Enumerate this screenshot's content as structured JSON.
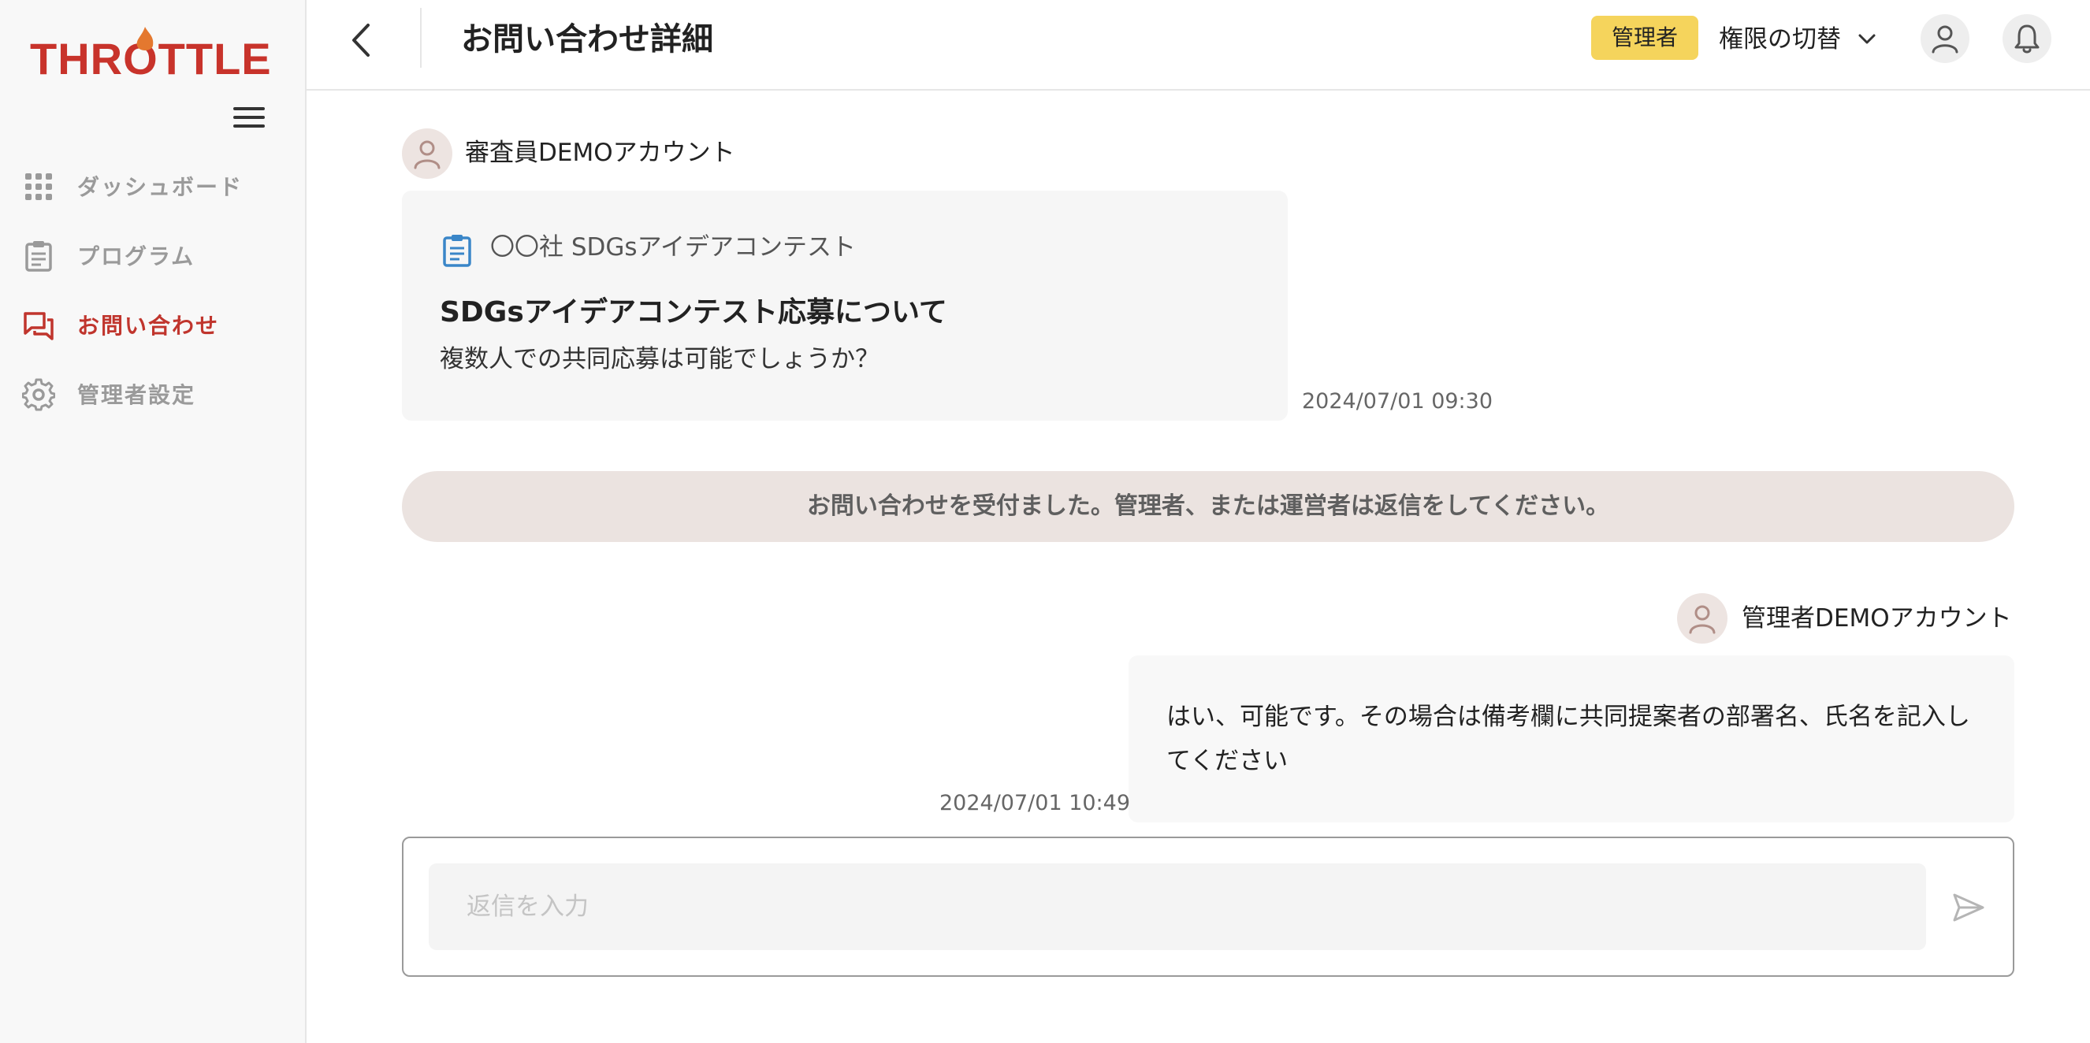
{
  "sidebar": {
    "logo_text": "THROTTLE",
    "items": [
      {
        "label": "ダッシュボード",
        "icon": "grid-icon",
        "active": false
      },
      {
        "label": "プログラム",
        "icon": "clipboard-icon",
        "active": false
      },
      {
        "label": "お問い合わせ",
        "icon": "chat-icon",
        "active": true
      },
      {
        "label": "管理者設定",
        "icon": "gear-icon",
        "active": false
      }
    ]
  },
  "header": {
    "title": "お問い合わせ詳細",
    "role_badge": "管理者",
    "role_switch_label": "権限の切替"
  },
  "thread": {
    "inquiry": {
      "sender": "審査員DEMOアカウント",
      "program": "〇〇社 SDGsアイデアコンテスト",
      "subject": "SDGsアイデアコンテスト応募について",
      "body": "複数人での共同応募は可能でしょうか？",
      "timestamp": "2024/07/01 09:30"
    },
    "system_message": "お問い合わせを受付ました。管理者、または運営者は返信をしてください。",
    "reply": {
      "sender": "管理者DEMOアカウント",
      "body": "はい、可能です。その場合は備考欄に共同提案者の部署名、氏名を記入してください",
      "timestamp": "2024/07/01 10:49"
    }
  },
  "composer": {
    "placeholder": "返信を入力",
    "value": ""
  },
  "colors": {
    "brand": "#c8332b",
    "active_nav": "#c0352d",
    "badge": "#f5d45c",
    "banner": "#ebe3e0",
    "program_icon": "#3a86c8"
  }
}
